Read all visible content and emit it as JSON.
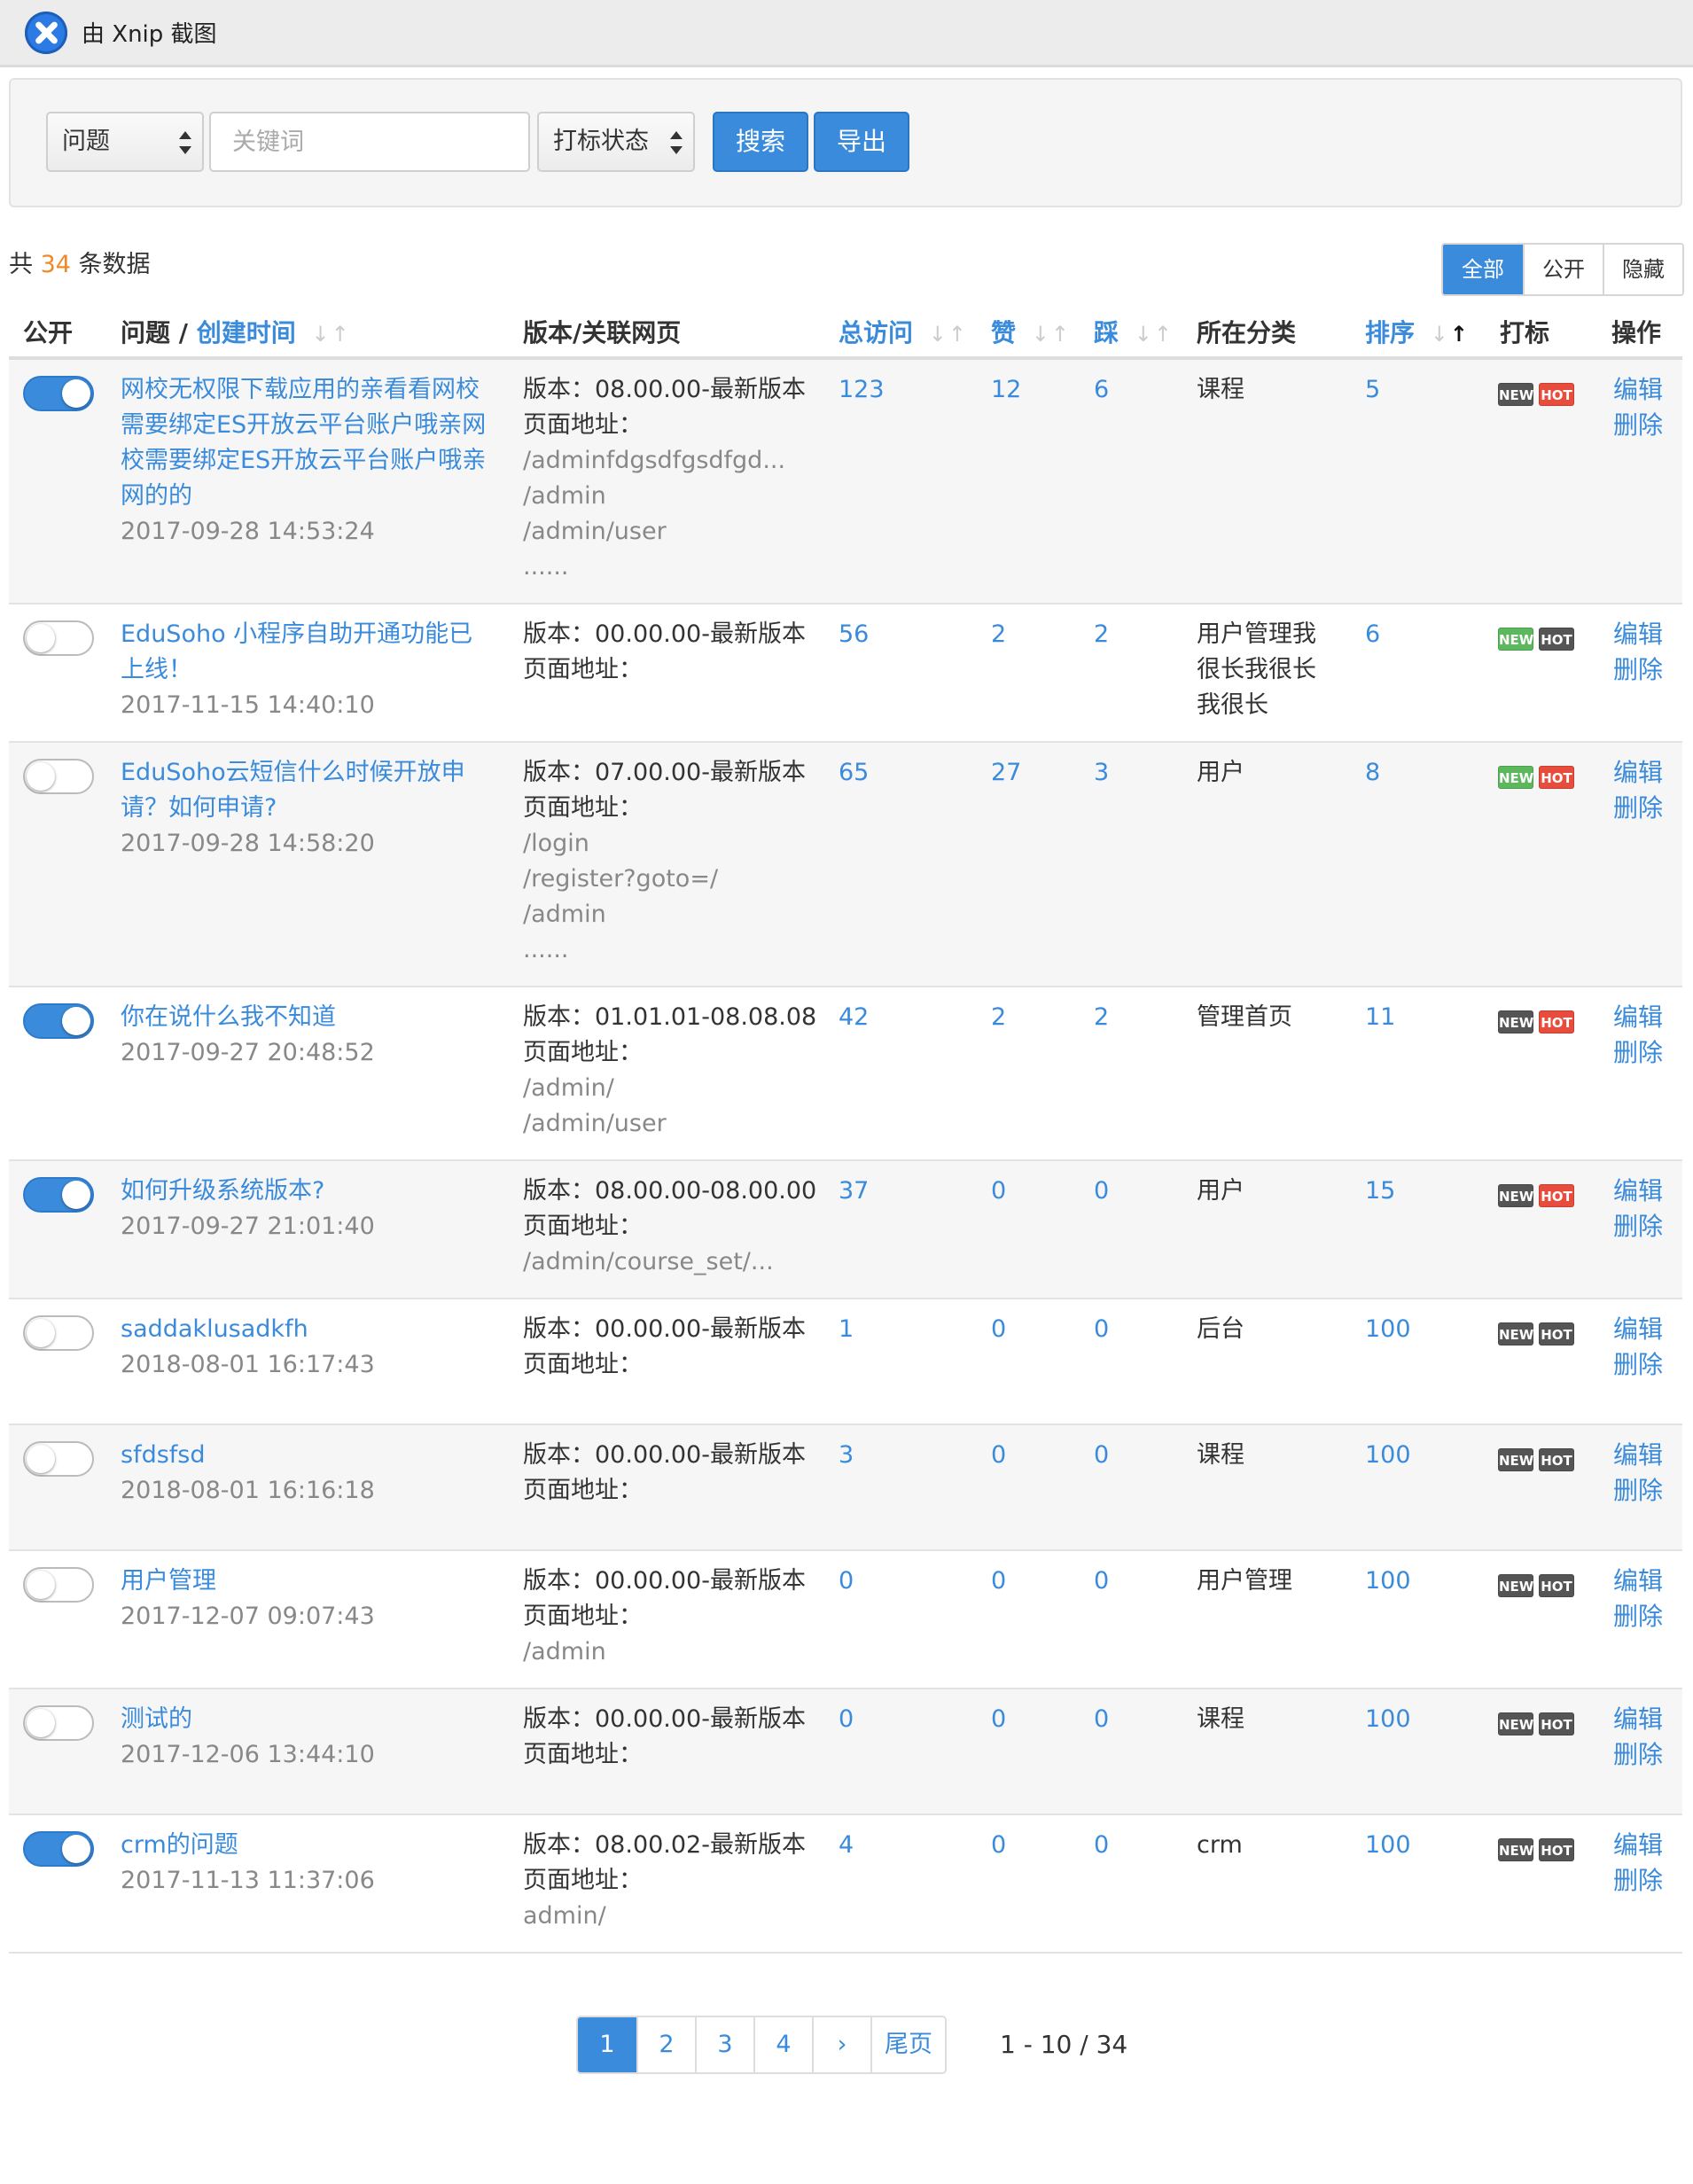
{
  "app": {
    "title": "由 Xnip 截图"
  },
  "search": {
    "type_select": "问题",
    "keyword_placeholder": "关键词",
    "status_select": "打标状态",
    "search_label": "搜索",
    "export_label": "导出"
  },
  "summary": {
    "prefix": "共",
    "count": "34",
    "suffix": "条数据"
  },
  "filter": {
    "all": "全部",
    "public": "公开",
    "hidden": "隐藏"
  },
  "headers": {
    "public": "公开",
    "question": "问题 /",
    "created": "创建时间",
    "version": "版本/关联网页",
    "visits": "总访问",
    "likes": "赞",
    "dislikes": "踩",
    "category": "所在分类",
    "order": "排序",
    "tag": "打标",
    "action": "操作"
  },
  "rows": [
    {
      "public": true,
      "title": "网校无权限下载应用的亲看看网校需要绑定ES开放云平台账户哦亲网校需要绑定ES开放云平台账户哦亲网的的",
      "time": "2017-09-28 14:53:24",
      "version": "版本：08.00.00-最新版本",
      "page_label": "页面地址：",
      "paths": [
        "/adminfdgsdfgsdfgd...",
        "/admin",
        "/admin/user",
        "......"
      ],
      "visits": "123",
      "likes": "12",
      "dislikes": "6",
      "category": "课程",
      "order": "5",
      "new_on": false,
      "hot_on": true
    },
    {
      "public": false,
      "title": "EduSoho 小程序自助开通功能已上线！",
      "time": "2017-11-15 14:40:10",
      "version": "版本：00.00.00-最新版本",
      "page_label": "页面地址：",
      "paths": [],
      "visits": "56",
      "likes": "2",
      "dislikes": "2",
      "category": "用户管理我很长我很长我很长",
      "order": "6",
      "new_on": true,
      "hot_on": false
    },
    {
      "public": false,
      "title": "EduSoho云短信什么时候开放申请？如何申请?",
      "time": "2017-09-28 14:58:20",
      "version": "版本：07.00.00-最新版本",
      "page_label": "页面地址：",
      "paths": [
        "/login",
        "/register?goto=/",
        "/admin",
        "......"
      ],
      "visits": "65",
      "likes": "27",
      "dislikes": "3",
      "category": "用户",
      "order": "8",
      "new_on": true,
      "hot_on": true
    },
    {
      "public": true,
      "title": "你在说什么我不知道",
      "time": "2017-09-27 20:48:52",
      "version": "版本：01.01.01-08.08.08",
      "page_label": "页面地址：",
      "paths": [
        "/admin/",
        "/admin/user"
      ],
      "visits": "42",
      "likes": "2",
      "dislikes": "2",
      "category": "管理首页",
      "order": "11",
      "new_on": false,
      "hot_on": true
    },
    {
      "public": true,
      "title": "如何升级系统版本?",
      "time": "2017-09-27 21:01:40",
      "version": "版本：08.00.00-08.00.00",
      "page_label": "页面地址：",
      "paths": [
        "/admin/course_set/..."
      ],
      "visits": "37",
      "likes": "0",
      "dislikes": "0",
      "category": "用户",
      "order": "15",
      "new_on": false,
      "hot_on": true
    },
    {
      "public": false,
      "title": "saddaklusadkfh",
      "time": "2018-08-01 16:17:43",
      "version": "版本：00.00.00-最新版本",
      "page_label": "页面地址：",
      "paths": [],
      "visits": "1",
      "likes": "0",
      "dislikes": "0",
      "category": "后台",
      "order": "100",
      "new_on": false,
      "hot_on": false
    },
    {
      "public": false,
      "title": "sfdsfsd",
      "time": "2018-08-01 16:16:18",
      "version": "版本：00.00.00-最新版本",
      "page_label": "页面地址：",
      "paths": [],
      "visits": "3",
      "likes": "0",
      "dislikes": "0",
      "category": "课程",
      "order": "100",
      "new_on": false,
      "hot_on": false
    },
    {
      "public": false,
      "title": "用户管理",
      "time": "2017-12-07 09:07:43",
      "version": "版本：00.00.00-最新版本",
      "page_label": "页面地址：",
      "paths": [
        "/admin"
      ],
      "visits": "0",
      "likes": "0",
      "dislikes": "0",
      "category": "用户管理",
      "order": "100",
      "new_on": false,
      "hot_on": false
    },
    {
      "public": false,
      "title": "测试的",
      "time": "2017-12-06 13:44:10",
      "version": "版本：00.00.00-最新版本",
      "page_label": "页面地址：",
      "paths": [],
      "visits": "0",
      "likes": "0",
      "dislikes": "0",
      "category": "课程",
      "order": "100",
      "new_on": false,
      "hot_on": false
    },
    {
      "public": true,
      "title": "crm的问题",
      "time": "2017-11-13 11:37:06",
      "version": "版本：08.00.02-最新版本",
      "page_label": "页面地址：",
      "paths": [
        "admin/"
      ],
      "visits": "4",
      "likes": "0",
      "dislikes": "0",
      "category": "crm",
      "order": "100",
      "new_on": false,
      "hot_on": false
    }
  ],
  "badges": {
    "new": "NEW",
    "hot": "HOT"
  },
  "actions": {
    "edit": "编辑",
    "delete": "删除"
  },
  "pagination": {
    "pages": [
      "1",
      "2",
      "3",
      "4",
      "›",
      "尾页"
    ],
    "active": "1",
    "info": "1 - 10 / 34"
  },
  "colors": {
    "accent": "#3a8bdb",
    "count": "#f0892a",
    "new_on": "#5cb85c",
    "hot_on": "#e74c3c",
    "badge_off": "#555555"
  }
}
